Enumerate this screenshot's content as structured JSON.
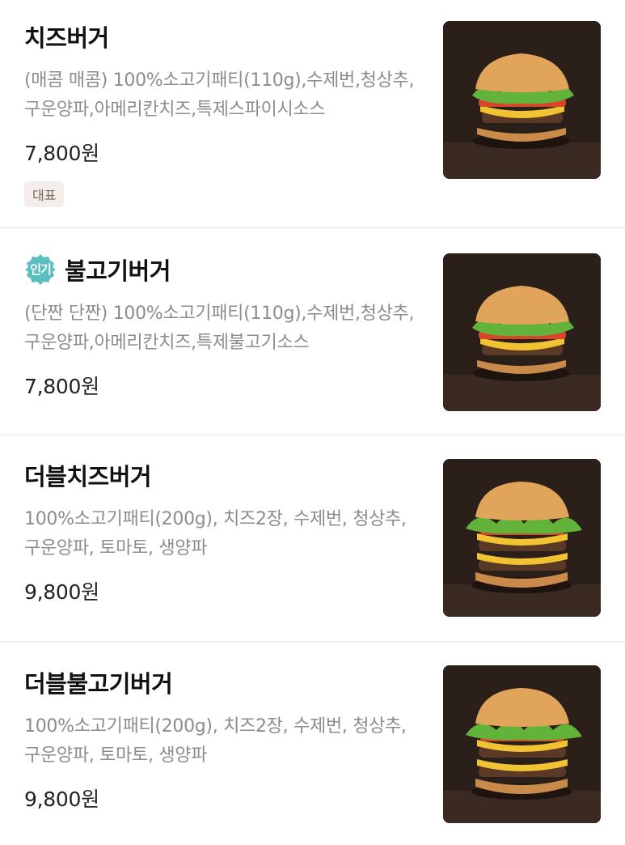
{
  "menu": {
    "items": [
      {
        "name": "치즈버거",
        "description": "(매콤 매콤) 100%소고기패티(110g),수제번,청상추,구운양파,아메리칸치즈,특제스파이시소스",
        "price": "7,800원",
        "tag": "대표",
        "popular_badge": null
      },
      {
        "name": "불고기버거",
        "description": "(단짠 단짠) 100%소고기패티(110g),수제번,청상추,구운양파,아메리칸치즈,특제불고기소스",
        "price": "7,800원",
        "tag": null,
        "popular_badge": "인기"
      },
      {
        "name": "더블치즈버거",
        "description": "100%소고기패티(200g), 치즈2장, 수제번, 청상추, 구운양파, 토마토, 생양파",
        "price": "9,800원",
        "tag": null,
        "popular_badge": null
      },
      {
        "name": "더블불고기버거",
        "description": "100%소고기패티(200g), 치즈2장, 수제번, 청상추, 구운양파, 토마토, 생양파",
        "price": "9,800원",
        "tag": null,
        "popular_badge": null
      }
    ]
  },
  "colors": {
    "popular_badge": "#5bbfc0",
    "tag_background": "#f3eeea",
    "tag_text": "#7e6a5c",
    "description_text": "#8c8c8c",
    "photo_background": "#2b1f1a"
  }
}
